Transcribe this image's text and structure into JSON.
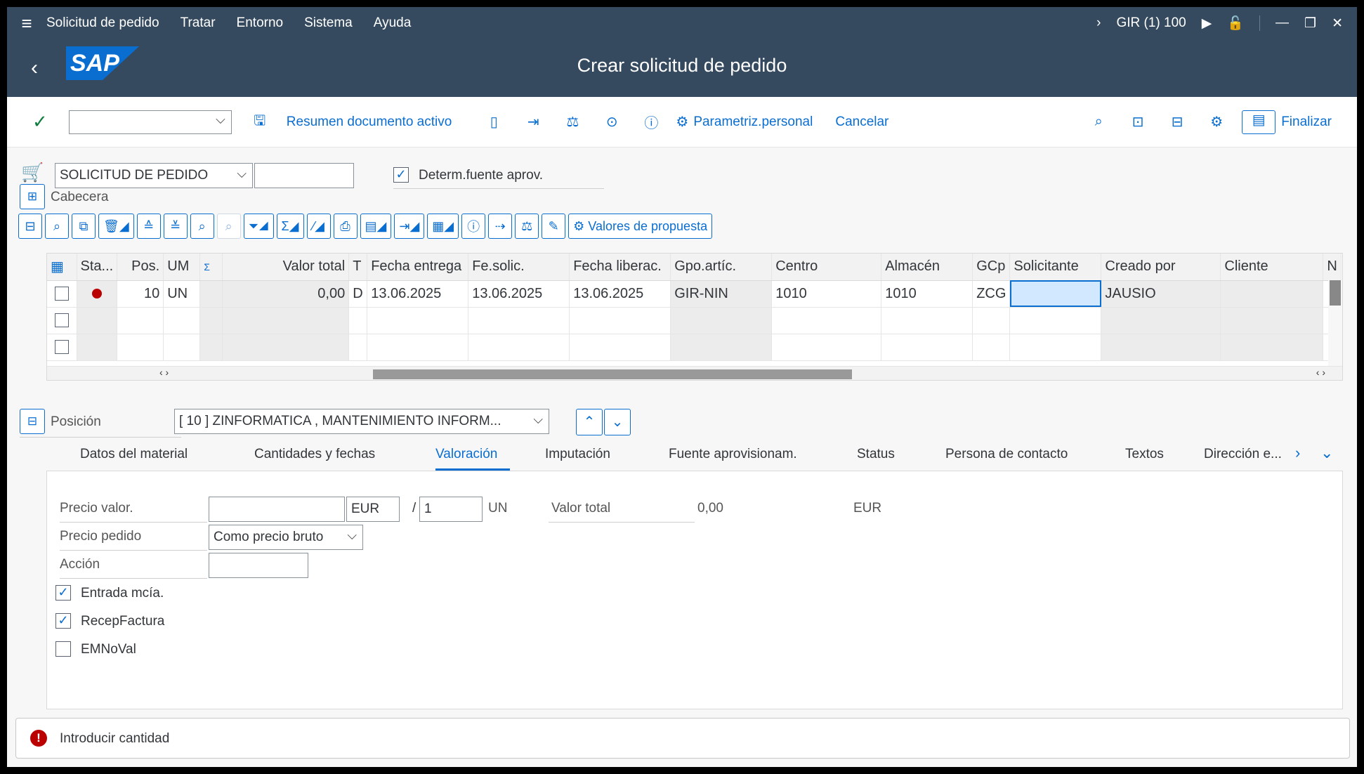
{
  "menu": {
    "items": [
      "Solicitud de pedido",
      "Tratar",
      "Entorno",
      "Sistema",
      "Ayuda"
    ],
    "system": "GIR (1) 100"
  },
  "title": "Crear solicitud de pedido",
  "logo": "SAP",
  "toolbar": {
    "summary": "Resumen documento activo",
    "personal": "Parametriz.personal",
    "cancel": "Cancelar",
    "finish": "Finalizar"
  },
  "header": {
    "doc_type": "SOLICITUD DE PEDIDO",
    "doc_number": "",
    "source_label": "Determ.fuente aprov.",
    "source_checked": true,
    "section": "Cabecera"
  },
  "alv": {
    "proposal": "Valores de propuesta"
  },
  "table": {
    "columns": [
      "Sta...",
      "Pos.",
      "UM",
      "Σ",
      "Valor total",
      "T",
      "Fecha entrega",
      "Fe.solic.",
      "Fecha liberac.",
      "Gpo.artíc.",
      "Centro",
      "Almacén",
      "GCp",
      "Solicitante",
      "Creado por",
      "Cliente",
      "N"
    ],
    "row": {
      "pos": "10",
      "um": "UN",
      "value": "0,00",
      "t": "D",
      "delivery": "13.06.2025",
      "req_date": "13.06.2025",
      "release": "13.06.2025",
      "group": "GIR-NIN",
      "plant": "1010",
      "storage": "1010",
      "gcp": "ZCG",
      "requester": "",
      "created_by": "JAUSIO",
      "customer": ""
    }
  },
  "position": {
    "label": "Posición",
    "value": "[ 10 ] ZINFORMATICA , MANTENIMIENTO INFORM..."
  },
  "tabs": [
    "Datos del material",
    "Cantidades y fechas",
    "Valoración",
    "Imputación",
    "Fuente aprovisionam.",
    "Status",
    "Persona de contacto",
    "Textos",
    "Dirección e..."
  ],
  "valuation": {
    "price_label": "Precio valor.",
    "price_value": "",
    "currency": "EUR",
    "per": "/",
    "per_qty": "1",
    "unit": "UN",
    "total_label": "Valor total",
    "total_value": "0,00",
    "total_currency": "EUR",
    "order_price_label": "Precio pedido",
    "order_price_value": "Como precio bruto",
    "action_label": "Acción",
    "action_value": "",
    "gr_label": "Entrada mcía.",
    "gr_checked": true,
    "ir_label": "RecepFactura",
    "ir_checked": true,
    "nonval_label": "EMNoVal",
    "nonval_checked": false
  },
  "status": {
    "message": "Introducir cantidad"
  }
}
